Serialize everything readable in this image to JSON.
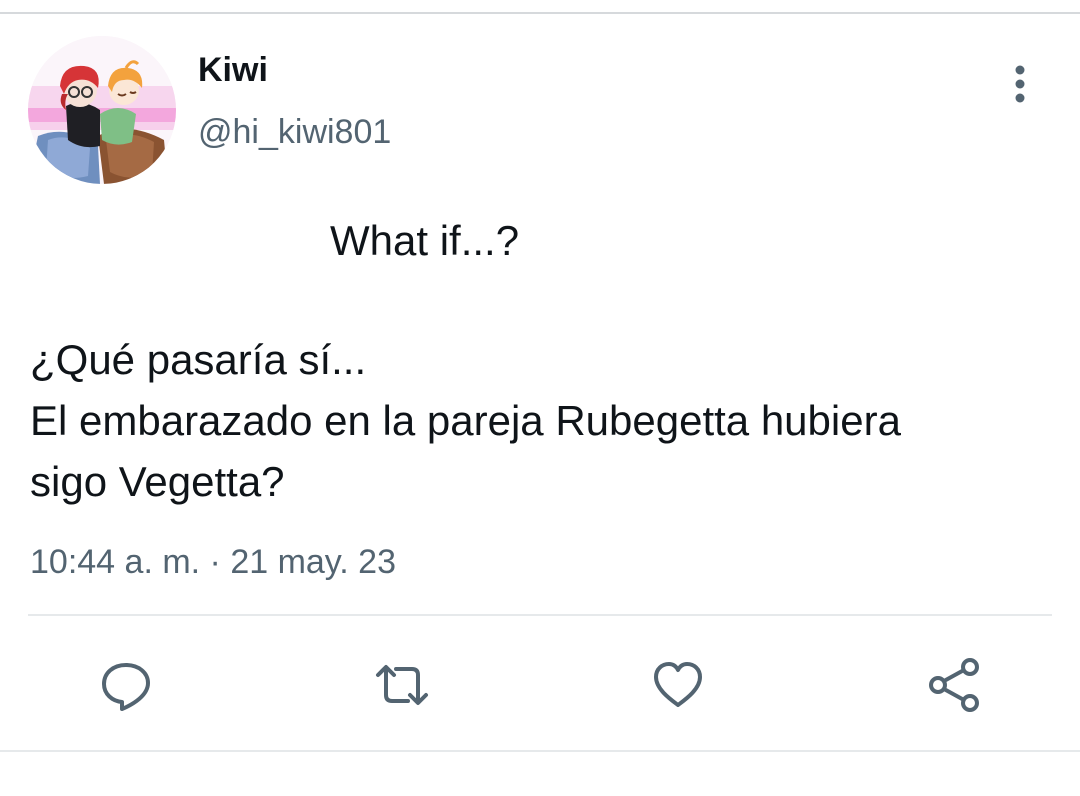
{
  "tweet": {
    "author": {
      "display_name": "Kiwi",
      "handle": "@hi_kiwi801"
    },
    "text_lines": [
      "What if...?",
      "",
      "¿Qué pasaría sí...",
      "El embarazado en la pareja Rubegetta hubiera",
      "sigo Vegetta?"
    ],
    "timestamp": "10:44 a. m. · 21 may. 23"
  },
  "actions": {
    "reply_icon": "reply-icon",
    "retweet_icon": "retweet-icon",
    "like_icon": "heart-icon",
    "share_icon": "share-icon",
    "more_icon": "more-vertical-icon"
  },
  "colors": {
    "text": "#0f1419",
    "secondary": "#536471",
    "divider": "#e6e9eb"
  }
}
